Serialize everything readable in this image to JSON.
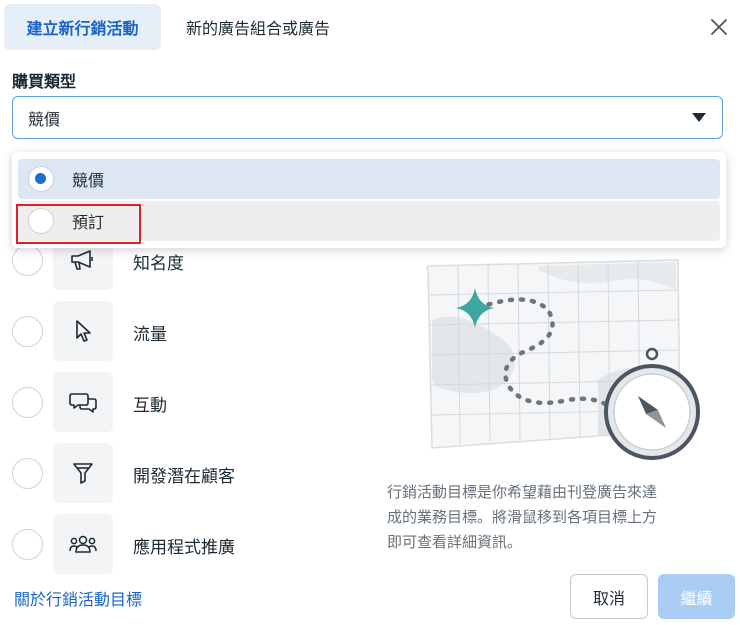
{
  "header": {
    "tabs": [
      {
        "label": "建立新行銷活動",
        "active": true
      },
      {
        "label": "新的廣告組合或廣告",
        "active": false
      }
    ],
    "close_icon": "close-icon"
  },
  "buying_type": {
    "label": "購買類型",
    "selected_value": "競價",
    "options": [
      {
        "label": "競價",
        "selected": true
      },
      {
        "label": "預訂",
        "selected": false
      }
    ]
  },
  "objectives": [
    {
      "label": "知名度",
      "icon": "megaphone-icon"
    },
    {
      "label": "流量",
      "icon": "cursor-icon"
    },
    {
      "label": "互動",
      "icon": "chat-bubbles-icon"
    },
    {
      "label": "開發潛在顧客",
      "icon": "funnel-icon"
    },
    {
      "label": "應用程式推廣",
      "icon": "people-icon"
    }
  ],
  "description": {
    "line1": "行銷活動目標是你希望藉由刊登廣告來達",
    "line2": "成的業務目標。將滑鼠移到各項目標上方",
    "line3": "即可查看詳細資訊。"
  },
  "footer": {
    "link": "關於行銷活動目標",
    "cancel": "取消",
    "continue": "繼續"
  },
  "colors": {
    "accent": "#1a63c7",
    "tab_active_bg": "#e6eef8",
    "continue_disabled": "#a9cdf2",
    "highlight": "#e0202a"
  }
}
